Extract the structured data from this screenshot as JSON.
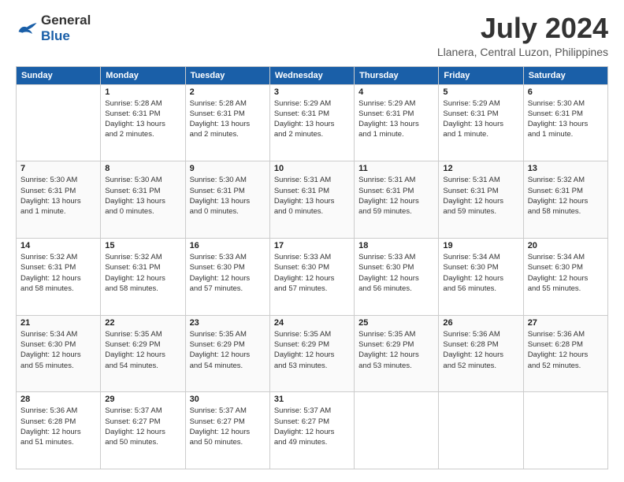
{
  "header": {
    "logo_general": "General",
    "logo_blue": "Blue",
    "month_year": "July 2024",
    "location": "Llanera, Central Luzon, Philippines"
  },
  "weekdays": [
    "Sunday",
    "Monday",
    "Tuesday",
    "Wednesday",
    "Thursday",
    "Friday",
    "Saturday"
  ],
  "weeks": [
    [
      {
        "date": "",
        "info": ""
      },
      {
        "date": "1",
        "info": "Sunrise: 5:28 AM\nSunset: 6:31 PM\nDaylight: 13 hours\nand 2 minutes."
      },
      {
        "date": "2",
        "info": "Sunrise: 5:28 AM\nSunset: 6:31 PM\nDaylight: 13 hours\nand 2 minutes."
      },
      {
        "date": "3",
        "info": "Sunrise: 5:29 AM\nSunset: 6:31 PM\nDaylight: 13 hours\nand 2 minutes."
      },
      {
        "date": "4",
        "info": "Sunrise: 5:29 AM\nSunset: 6:31 PM\nDaylight: 13 hours\nand 1 minute."
      },
      {
        "date": "5",
        "info": "Sunrise: 5:29 AM\nSunset: 6:31 PM\nDaylight: 13 hours\nand 1 minute."
      },
      {
        "date": "6",
        "info": "Sunrise: 5:30 AM\nSunset: 6:31 PM\nDaylight: 13 hours\nand 1 minute."
      }
    ],
    [
      {
        "date": "7",
        "info": "Sunrise: 5:30 AM\nSunset: 6:31 PM\nDaylight: 13 hours\nand 1 minute."
      },
      {
        "date": "8",
        "info": "Sunrise: 5:30 AM\nSunset: 6:31 PM\nDaylight: 13 hours\nand 0 minutes."
      },
      {
        "date": "9",
        "info": "Sunrise: 5:30 AM\nSunset: 6:31 PM\nDaylight: 13 hours\nand 0 minutes."
      },
      {
        "date": "10",
        "info": "Sunrise: 5:31 AM\nSunset: 6:31 PM\nDaylight: 13 hours\nand 0 minutes."
      },
      {
        "date": "11",
        "info": "Sunrise: 5:31 AM\nSunset: 6:31 PM\nDaylight: 12 hours\nand 59 minutes."
      },
      {
        "date": "12",
        "info": "Sunrise: 5:31 AM\nSunset: 6:31 PM\nDaylight: 12 hours\nand 59 minutes."
      },
      {
        "date": "13",
        "info": "Sunrise: 5:32 AM\nSunset: 6:31 PM\nDaylight: 12 hours\nand 58 minutes."
      }
    ],
    [
      {
        "date": "14",
        "info": "Sunrise: 5:32 AM\nSunset: 6:31 PM\nDaylight: 12 hours\nand 58 minutes."
      },
      {
        "date": "15",
        "info": "Sunrise: 5:32 AM\nSunset: 6:31 PM\nDaylight: 12 hours\nand 58 minutes."
      },
      {
        "date": "16",
        "info": "Sunrise: 5:33 AM\nSunset: 6:30 PM\nDaylight: 12 hours\nand 57 minutes."
      },
      {
        "date": "17",
        "info": "Sunrise: 5:33 AM\nSunset: 6:30 PM\nDaylight: 12 hours\nand 57 minutes."
      },
      {
        "date": "18",
        "info": "Sunrise: 5:33 AM\nSunset: 6:30 PM\nDaylight: 12 hours\nand 56 minutes."
      },
      {
        "date": "19",
        "info": "Sunrise: 5:34 AM\nSunset: 6:30 PM\nDaylight: 12 hours\nand 56 minutes."
      },
      {
        "date": "20",
        "info": "Sunrise: 5:34 AM\nSunset: 6:30 PM\nDaylight: 12 hours\nand 55 minutes."
      }
    ],
    [
      {
        "date": "21",
        "info": "Sunrise: 5:34 AM\nSunset: 6:30 PM\nDaylight: 12 hours\nand 55 minutes."
      },
      {
        "date": "22",
        "info": "Sunrise: 5:35 AM\nSunset: 6:29 PM\nDaylight: 12 hours\nand 54 minutes."
      },
      {
        "date": "23",
        "info": "Sunrise: 5:35 AM\nSunset: 6:29 PM\nDaylight: 12 hours\nand 54 minutes."
      },
      {
        "date": "24",
        "info": "Sunrise: 5:35 AM\nSunset: 6:29 PM\nDaylight: 12 hours\nand 53 minutes."
      },
      {
        "date": "25",
        "info": "Sunrise: 5:35 AM\nSunset: 6:29 PM\nDaylight: 12 hours\nand 53 minutes."
      },
      {
        "date": "26",
        "info": "Sunrise: 5:36 AM\nSunset: 6:28 PM\nDaylight: 12 hours\nand 52 minutes."
      },
      {
        "date": "27",
        "info": "Sunrise: 5:36 AM\nSunset: 6:28 PM\nDaylight: 12 hours\nand 52 minutes."
      }
    ],
    [
      {
        "date": "28",
        "info": "Sunrise: 5:36 AM\nSunset: 6:28 PM\nDaylight: 12 hours\nand 51 minutes."
      },
      {
        "date": "29",
        "info": "Sunrise: 5:37 AM\nSunset: 6:27 PM\nDaylight: 12 hours\nand 50 minutes."
      },
      {
        "date": "30",
        "info": "Sunrise: 5:37 AM\nSunset: 6:27 PM\nDaylight: 12 hours\nand 50 minutes."
      },
      {
        "date": "31",
        "info": "Sunrise: 5:37 AM\nSunset: 6:27 PM\nDaylight: 12 hours\nand 49 minutes."
      },
      {
        "date": "",
        "info": ""
      },
      {
        "date": "",
        "info": ""
      },
      {
        "date": "",
        "info": ""
      }
    ]
  ]
}
